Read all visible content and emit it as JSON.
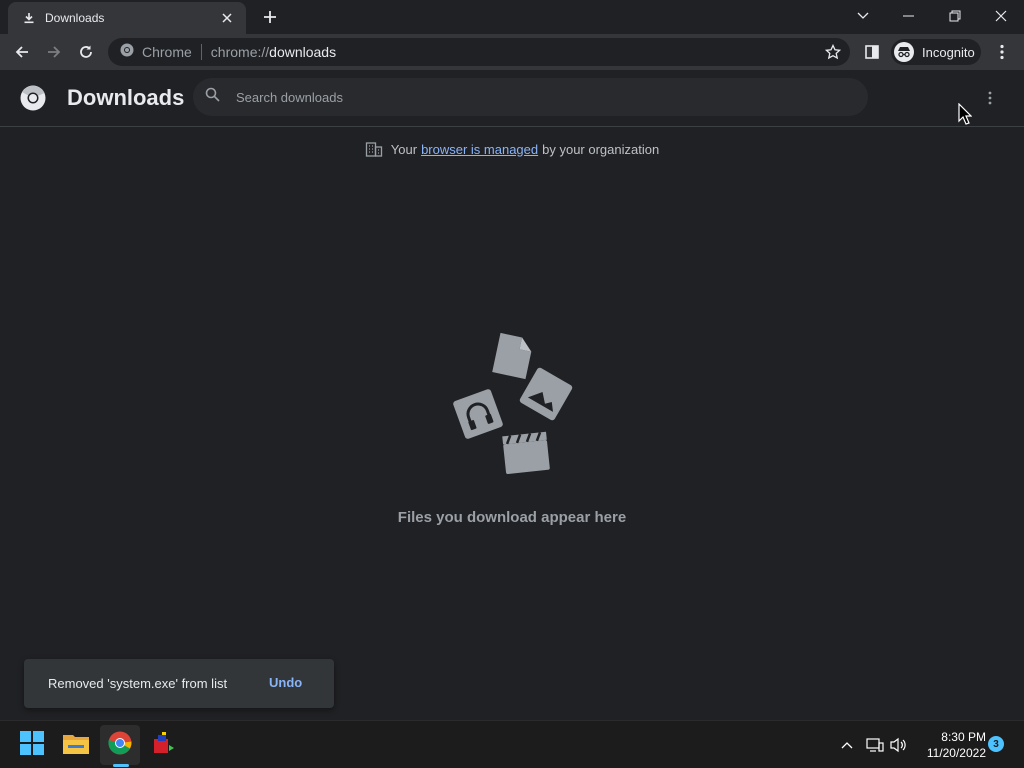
{
  "tab": {
    "title": "Downloads"
  },
  "omnibox": {
    "scheme_label": "Chrome",
    "url_prefix": "chrome://",
    "url_path": "downloads"
  },
  "profile": {
    "label": "Incognito"
  },
  "page": {
    "title": "Downloads",
    "search_placeholder": "Search downloads",
    "managed_prefix": "Your",
    "managed_link": "browser is managed",
    "managed_suffix": "by your organization",
    "empty_message": "Files you download appear here"
  },
  "toast": {
    "message": "Removed 'system.exe' from list",
    "action": "Undo"
  },
  "taskbar": {
    "time": "8:30 PM",
    "date": "11/20/2022",
    "notification_count": "3",
    "apps": [
      "start-icon",
      "file-explorer-icon",
      "chrome-icon",
      "app-icon"
    ]
  },
  "colors": {
    "page_bg": "#202124",
    "toolbar_bg": "#35363a",
    "link": "#8ab4f8",
    "taskbar_bg": "#1c1c1c",
    "accent": "#4cc2ff"
  }
}
